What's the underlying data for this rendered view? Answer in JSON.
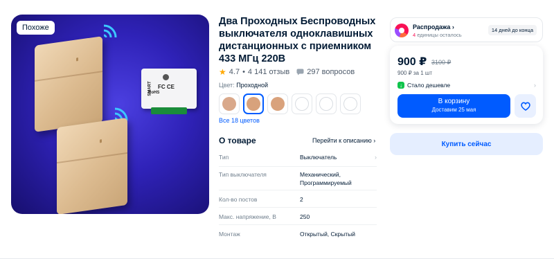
{
  "gallery": {
    "badge": "Похоже",
    "receiver_marks": [
      "SMART",
      "RoHS",
      "FC CE"
    ]
  },
  "product": {
    "title": "Два Проходных Беспроводных выключателя одноклавишных дистанционных с приемником 433 МГц 220В",
    "rating": "4.7",
    "separator": "•",
    "reviews": "4 141 отзыв",
    "questions": "297 вопросов",
    "color_label": "Цвет:",
    "color_value": "Проходной",
    "swatch_colors": [
      "#d9a88a",
      "#d8a27c",
      "#d9a27c",
      "#ffffff",
      "#ffffff",
      "#ffffff"
    ],
    "all_colors_link": "Все 18 цветов"
  },
  "about": {
    "title": "О товаре",
    "description_link": "Перейти к описанию ›",
    "specs": [
      {
        "key": "Тип",
        "value": "Выключатель"
      },
      {
        "key": "Тип выключателя",
        "value": "Механический, Программируемый"
      },
      {
        "key": "Кол-во постов",
        "value": "2"
      },
      {
        "key": "Макс. напряжение, В",
        "value": "250"
      },
      {
        "key": "Монтаж",
        "value": "Открытый, Скрытый"
      }
    ]
  },
  "sale": {
    "name": "Распродажа ›",
    "count": "4",
    "count_suffix": "единицы осталось",
    "days_left": "14 дней до конца"
  },
  "price": {
    "current": "900 ₽",
    "old": "3100 ₽",
    "per_unit": "900 ₽ за 1 шт",
    "cheaper_text": "Стало дешевле",
    "cart_label": "В корзину",
    "delivery": "Доставим 25 мая",
    "buy_now": "Купить сейчас"
  },
  "colors": {
    "accent": "#005bff",
    "text": "#001a34",
    "muted": "#707f8d",
    "sale_pink": "#f91155",
    "green": "#10c44c",
    "rating_star": "#ffa800"
  },
  "icons": [
    "star-icon",
    "questions-icon",
    "heart-icon",
    "chevron-right-icon",
    "wifi-icon",
    "cheaper-check-icon"
  ]
}
